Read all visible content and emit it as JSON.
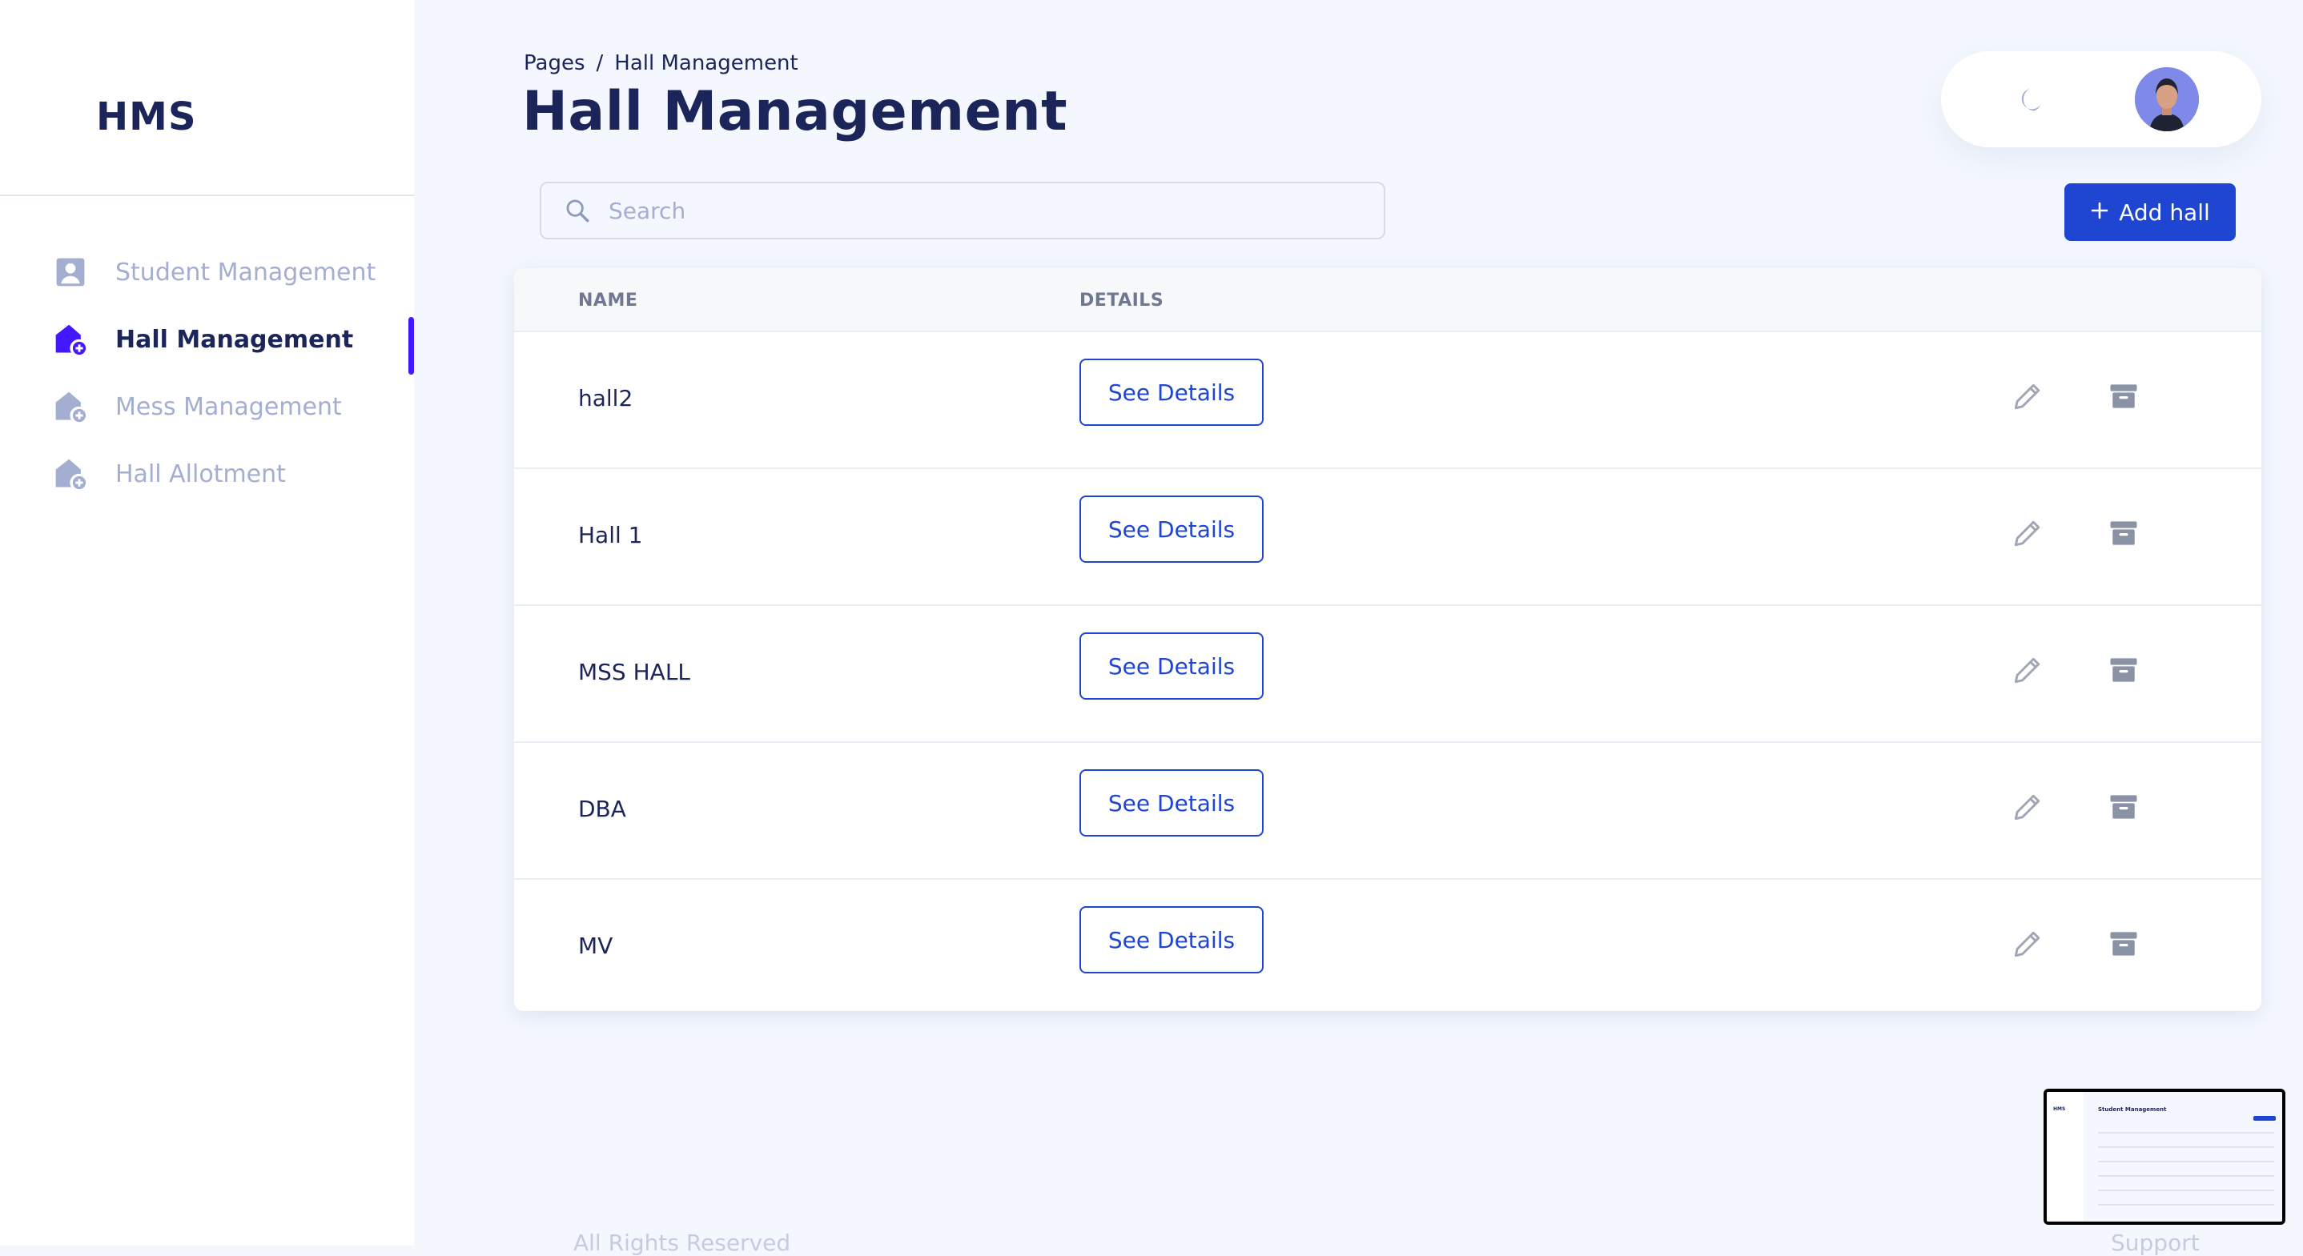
{
  "app": {
    "logo": "HMS"
  },
  "sidebar": {
    "items": [
      {
        "label": "Student Management",
        "icon": "user-square-icon",
        "active": false
      },
      {
        "label": "Hall Management",
        "icon": "home-add-icon",
        "active": true
      },
      {
        "label": "Mess Management",
        "icon": "home-add-icon",
        "active": false
      },
      {
        "label": "Hall Allotment",
        "icon": "home-add-icon",
        "active": false
      }
    ]
  },
  "header": {
    "breadcrumb": {
      "root": "Pages",
      "separator": "/",
      "current": "Hall Management"
    },
    "title": "Hall Management",
    "theme_icon": "moon-icon"
  },
  "toolbar": {
    "search_placeholder": "Search",
    "add_label": "Add hall"
  },
  "table": {
    "columns": {
      "name": "NAME",
      "details": "DETAILS"
    },
    "details_label": "See Details",
    "rows": [
      {
        "name": "hall2"
      },
      {
        "name": "Hall 1"
      },
      {
        "name": "MSS HALL"
      },
      {
        "name": "DBA"
      },
      {
        "name": "MV"
      }
    ]
  },
  "footer": {
    "left": "All Rights Reserved",
    "right": "Support"
  },
  "preview": {
    "logo": "HMS",
    "title": "Student Management"
  },
  "colors": {
    "accent": "#1f45d3",
    "active_bar": "#4318ff",
    "text_dark": "#1b2559",
    "text_muted": "#a3aed0",
    "background": "#f4f7fe"
  }
}
